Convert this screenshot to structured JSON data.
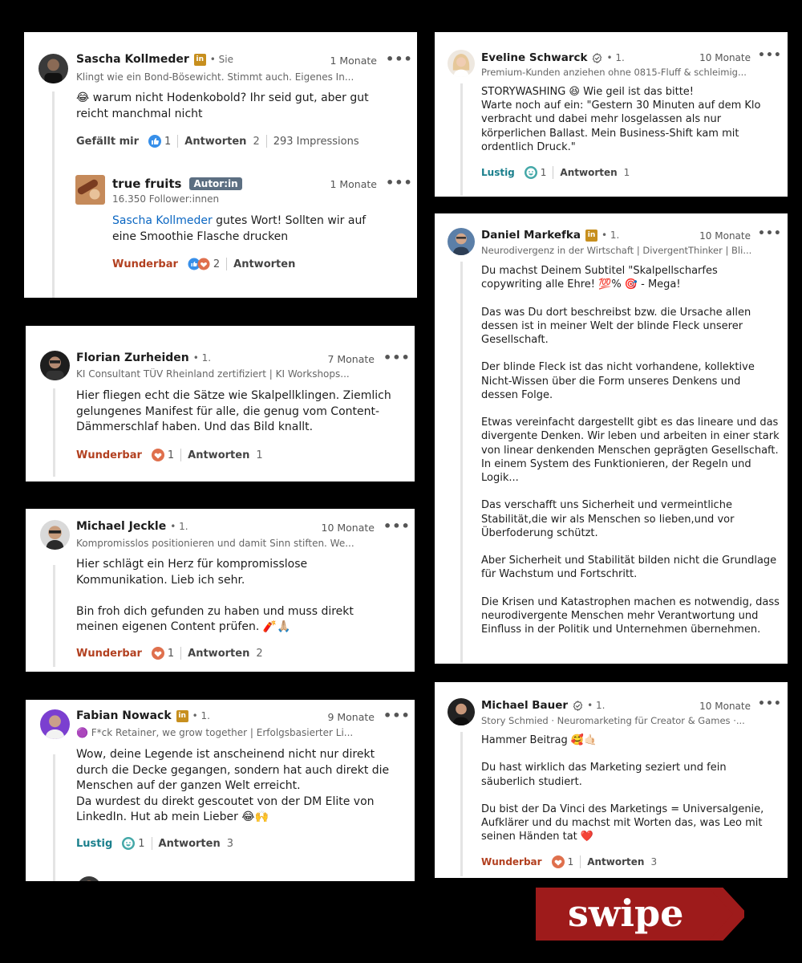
{
  "comments": [
    {
      "name": "Sascha Kollmeder",
      "badge": "in",
      "degree": "• Sie",
      "time": "1 Monate",
      "subtitle": "Klingt wie ein Bond-Bösewicht. Stimmt auch. Eigenes In...",
      "text": "😂 warum nicht Hodenkobold? Ihr seid gut, aber gut reicht manchmal nicht",
      "reaction_label": "Gefällt mir",
      "reaction_count": "1",
      "reply_label": "Antworten",
      "reply_count": "2",
      "impressions": "293 Impressions",
      "reply": {
        "name": "true fruits",
        "author_badge": "Autor:in",
        "time": "1 Monate",
        "followers": "16.350 Follower:innen",
        "mention": "Sascha Kollmeder",
        "text": " gutes Wort! Sollten wir auf eine Smoothie Flasche drucken",
        "reaction_label": "Wunderbar",
        "reaction_count": "2",
        "reply_label": "Antworten"
      }
    },
    {
      "name": "Florian Zurheiden",
      "degree": "• 1.",
      "time": "7 Monate",
      "subtitle": "KI Consultant TÜV Rheinland zertifiziert | KI Workshops...",
      "text": "Hier fliegen echt die Sätze wie Skalpellklingen. Ziemlich gelungenes Manifest für alle, die genug vom Content-Dämmerschlaf haben. Und das Bild knallt.",
      "reaction_label": "Wunderbar",
      "reaction_count": "1",
      "reply_label": "Antworten",
      "reply_count": "1"
    },
    {
      "name": "Michael Jeckle",
      "degree": "• 1.",
      "time": "10 Monate",
      "subtitle": "Kompromisslos positionieren und damit Sinn stiften. We...",
      "text": "Hier schlägt ein Herz für kompromisslose Kommunikation. Lieb ich sehr.\n\nBin froh dich gefunden zu haben und muss direkt meinen eigenen Content prüfen. 🧨🙏🏼",
      "reaction_label": "Wunderbar",
      "reaction_count": "1",
      "reply_label": "Antworten",
      "reply_count": "2"
    },
    {
      "name": "Fabian Nowack",
      "badge": "in",
      "degree": "• 1.",
      "time": "9 Monate",
      "subtitle": "🟣 F*ck Retainer, we grow together | Erfolgsbasierter Li...",
      "text": "Wow, deine Legende ist anscheinend nicht nur direkt durch die Decke gegangen, sondern hat auch direkt die Menschen auf der ganzen Welt erreicht.\nDa wurdest du direkt gescoutet von der DM Elite von LinkedIn. Hut ab mein Lieber 😂🙌",
      "reaction_label": "Lustig",
      "reaction_count": "1",
      "reply_label": "Antworten",
      "reply_count": "3"
    },
    {
      "name": "Eveline Schwarck",
      "degree": "• 1.",
      "time": "10 Monate",
      "subtitle": "Premium-Kunden anziehen ohne 0815-Fluff & schleimig...",
      "text": "STORYWASHING 😆 Wie geil ist das bitte!\nWarte noch auf ein: \"Gestern 30 Minuten auf dem Klo verbracht und dabei mehr losgelassen als nur körperlichen Ballast. Mein Business-Shift kam mit ordentlich Druck.\"",
      "reaction_label": "Lustig",
      "reaction_count": "1",
      "reply_label": "Antworten",
      "reply_count": "1"
    },
    {
      "name": "Daniel Markefka",
      "badge": "in",
      "degree": "• 1.",
      "time": "10 Monate",
      "subtitle": "Neurodivergenz in der Wirtschaft | DivergentThinker | Bli...",
      "text": "Du machst Deinem Subtitel \"Skalpellscharfes copywriting alle Ehre! 💯% 🎯 - Mega!\n\nDas was Du dort beschreibst bzw. die Ursache allen dessen ist in meiner Welt der blinde Fleck unserer Gesellschaft.\n\nDer blinde Fleck ist das nicht vorhandene, kollektive Nicht-Wissen über die Form unseres Denkens und dessen Folge.\n\nEtwas vereinfacht dargestellt gibt es das lineare und das divergente Denken. Wir leben und arbeiten in einer stark von linear denkenden Menschen geprägten Gesellschaft. In einem System des Funktionieren, der Regeln und Logik...\n\nDas verschafft uns Sicherheit und vermeintliche Stabilität,die wir als Menschen so lieben,und vor Überfoderung schützt.\n\nAber Sicherheit und Stabilität bilden nicht die Grundlage für Wachstum und Fortschritt.\n\nDie Krisen und Katastrophen machen es notwendig, dass neurodivergente Menschen mehr Verantwortung und Einfluss in der Politik und Unternehmen übernehmen."
    },
    {
      "name": "Michael Bauer",
      "degree": "• 1.",
      "time": "10 Monate",
      "subtitle": "Story Schmied · Neuromarketing für Creator & Games ·...",
      "text": "Hammer Beitrag 🥰🤙🏻\n\nDu hast wirklich das Marketing seziert und fein säuberlich studiert.\n\nDu bist der Da Vinci des Marketings = Universalgenie, Aufklärer und du machst mit Worten das, was Leo mit seinen Händen tat  ❤️",
      "reaction_label": "Wunderbar",
      "reaction_count": "1",
      "reply_label": "Antworten",
      "reply_count": "3"
    }
  ],
  "swipe_label": "swipe",
  "colors": {
    "brand_red": "#9e1b1b",
    "linkedin_gold": "#c78f1e",
    "wunderbar": "#b24020",
    "lustig": "#1a7f8c"
  }
}
